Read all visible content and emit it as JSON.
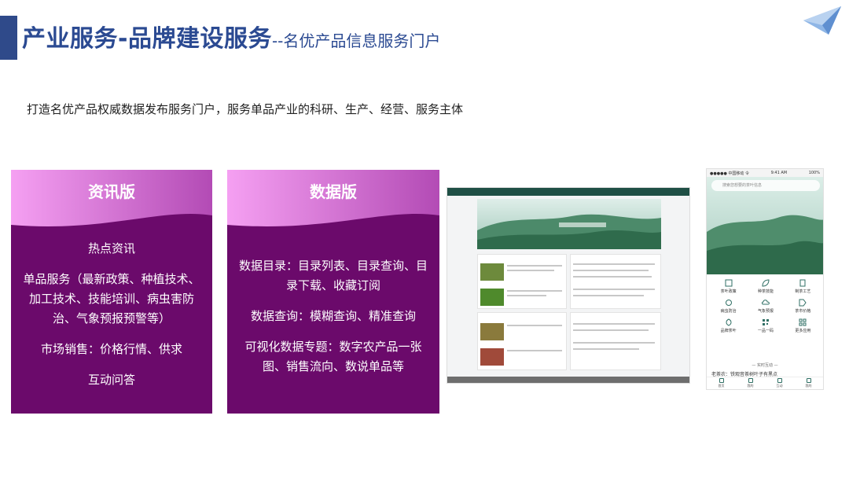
{
  "header": {
    "title_main": "产业服务-品牌建设服务",
    "title_sub": "--名优产品信息服务门户"
  },
  "subtitle": "打造名优产品权威数据发布服务门户，服务单品产业的科研、生产、经营、服务主体",
  "cards": {
    "info": {
      "title": "资讯版",
      "items": [
        "热点资讯",
        "单品服务（最新政策、种植技术、加工技术、技能培训、病虫害防治、气象预报预警等）",
        "市场销售：价格行情、供求",
        "互动问答"
      ]
    },
    "data": {
      "title": "数据版",
      "items": [
        "数据目录：目录列表、目录查询、目录下载、收藏订阅",
        "数据查询：模糊查询、精准查询",
        "可视化数据专题：数字农产品一张图、销售流向、数说单品等"
      ]
    }
  },
  "phone": {
    "status_left": "●●●●● 中国移动 令",
    "status_time": "9:41 AM",
    "status_right": "100%",
    "search_placeholder": "搜索您想要的茶叶信息",
    "grid": [
      "茶叶政策",
      "种茶技能",
      "制茶工艺",
      "病虫防治",
      "气象预报",
      "茶市价格",
      "品牌茶叶",
      "一品一码",
      "更多应用"
    ],
    "realtime": "— 实时互动 —",
    "realtime_line": "老茶农：铁观音茶树叶子有黑点",
    "tabs": [
      "首页",
      "我的",
      "互动",
      "我的"
    ]
  },
  "colors": {
    "title": "#2b4a92",
    "card_bg": "#6b0a6b",
    "card_head_light": "#f49cf0",
    "card_head_dark": "#8a1a8a",
    "web_nav": "#1f4f45"
  }
}
